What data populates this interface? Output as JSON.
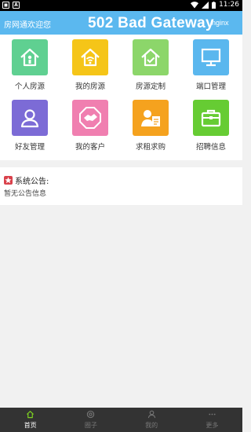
{
  "status_bar": {
    "time": "11:26"
  },
  "header": {
    "welcome": "房网通欢迎您",
    "error_title": "502 Bad Gateway",
    "error_server": "nginx"
  },
  "grid": {
    "items": [
      {
        "label": "个人房源",
        "icon": "house-icon",
        "color": "#5fd091"
      },
      {
        "label": "我的房源",
        "icon": "house-wifi-icon",
        "color": "#f5c518"
      },
      {
        "label": "房源定制",
        "icon": "house-check-icon",
        "color": "#8cd66a"
      },
      {
        "label": "端口管理",
        "icon": "monitor-icon",
        "color": "#5ab7ee"
      },
      {
        "label": "好友管理",
        "icon": "person-icon",
        "color": "#7c6bd6"
      },
      {
        "label": "我的客户",
        "icon": "handshake-icon",
        "color": "#f07fb0"
      },
      {
        "label": "求租求购",
        "icon": "person-document-icon",
        "color": "#f5a21e"
      },
      {
        "label": "招聘信息",
        "icon": "briefcase-icon",
        "color": "#66cc33"
      }
    ]
  },
  "notice": {
    "title": "系统公告:",
    "body": "暂无公告信息"
  },
  "tabs": [
    {
      "label": "首页",
      "icon": "home-icon",
      "active": true
    },
    {
      "label": "圈子",
      "icon": "circle-icon",
      "active": false
    },
    {
      "label": "我的",
      "icon": "user-icon",
      "active": false
    },
    {
      "label": "更多",
      "icon": "more-icon",
      "active": false
    }
  ],
  "colors": {
    "header": "#5bb8ef",
    "tab_bar": "#333333",
    "active_tab_icon": "#7ed321"
  }
}
